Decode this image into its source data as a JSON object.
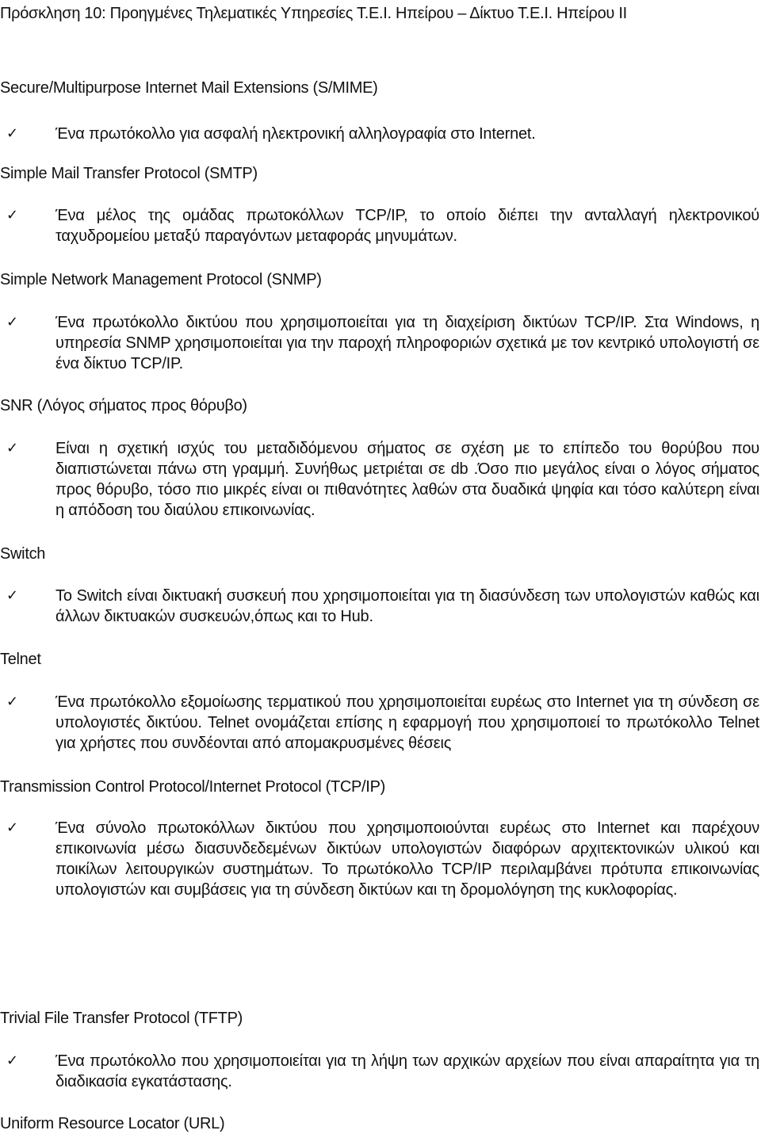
{
  "document": {
    "title": "Πρόσκληση 10: Προηγμένες Τηλεματικές Υπηρεσίες Τ.Ε.Ι. Ηπείρου – Δίκτυο Τ.Ε.Ι. Ηπείρου ΙΙ",
    "check_icon": "✓",
    "sections": [
      {
        "heading": "Secure/Multipurpose Internet Mail Extensions (S/MIME)",
        "bullet": "Ένα πρωτόκολλο για ασφαλή ηλεκτρονική αλληλογραφία στο Internet."
      },
      {
        "heading": "Simple Mail Transfer Protocol (SMTP)",
        "bullet": "Ένα μέλος της ομάδας πρωτοκόλλων TCP/IP, το οποίο διέπει την ανταλλαγή ηλεκτρονικού ταχυδρομείου μεταξύ παραγόντων μεταφοράς μηνυμάτων."
      },
      {
        "heading": "Simple Network Management Protocol (SNMP)",
        "bullet": "Ένα πρωτόκολλο δικτύου που χρησιμοποιείται για τη διαχείριση δικτύων TCP/IP. Στα Windows, η υπηρεσία SNMP χρησιμοποιείται για την παροχή πληροφοριών σχετικά με τον κεντρικό υπολογιστή σε ένα δίκτυο TCP/IP."
      },
      {
        "heading": "SNR (Λόγος σήματος προς θόρυβο)",
        "bullet": "Είναι η σχετική ισχύς του μεταδιδόμενου σήματος σε σχέση με το επίπεδο του θορύβου που διαπιστώνεται πάνω στη γραμμή. Συνήθως μετριέται σε db .Όσο πιο μεγάλος είναι ο λόγος σήματος προς θόρυβο, τόσο πιο μικρές είναι οι πιθανότητες λαθών στα δυαδικά ψηφία και τόσο καλύτερη είναι η απόδοση του διαύλου επικοινωνίας."
      },
      {
        "heading": "Switch",
        "bullet": "Το Switch είναι δικτυακή συσκευή που χρησιμοποιείται για τη διασύνδεση των υπολογιστών καθώς και άλλων δικτυακών συσκευών,όπως και το Hub."
      },
      {
        "heading": "Telnet",
        "bullet": "Ένα πρωτόκολλο εξομοίωσης τερματικού που χρησιμοποιείται ευρέως στο Internet για τη σύνδεση σε υπολογιστές δικτύου. Telnet ονομάζεται επίσης η εφαρμογή που χρησιμοποιεί το πρωτόκολλο Telnet για χρήστες που συνδέονται από απομακρυσμένες θέσεις"
      },
      {
        "heading": "Transmission Control Protocol/Internet Protocol (TCP/IP)",
        "bullet": "Ένα σύνολο πρωτοκόλλων δικτύου που χρησιμοποιούνται ευρέως στο Internet και παρέχουν επικοινωνία μέσω διασυνδεδεμένων δικτύων υπολογιστών διαφόρων αρχιτεκτονικών υλικού και ποικίλων λειτουργικών συστημάτων. Το πρωτόκολλο TCP/IP περιλαμβάνει πρότυπα επικοινωνίας υπολογιστών και συμβάσεις για τη σύνδεση δικτύων και τη δρομολόγηση της κυκλοφορίας."
      },
      {
        "heading": "Trivial File Transfer Protocol (TFTP)",
        "bullet": "Ένα πρωτόκολλο που χρησιμοποιείται για τη λήψη των αρχικών αρχείων που είναι απαραίτητα για τη διαδικασία εγκατάστασης."
      },
      {
        "heading": "Uniform Resource Locator (URL)"
      }
    ]
  }
}
